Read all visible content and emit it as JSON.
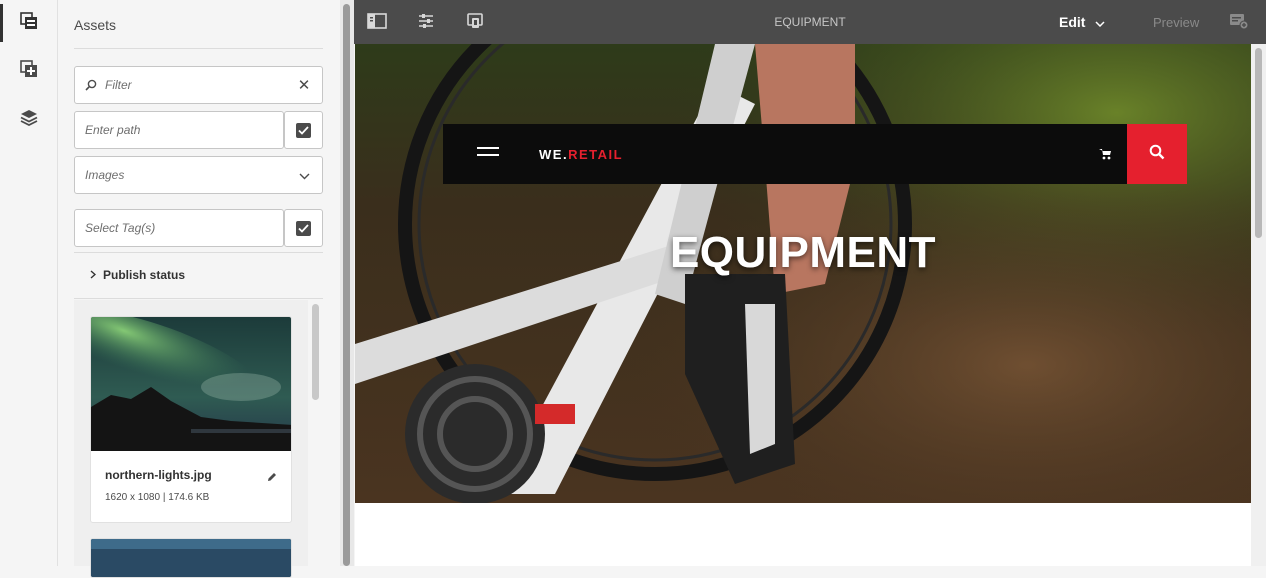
{
  "rail": {
    "items": [
      {
        "icon": "asset-finder-icon",
        "active": true
      },
      {
        "icon": "components-icon",
        "active": false
      },
      {
        "icon": "content-tree-icon",
        "active": false
      }
    ]
  },
  "panel": {
    "title": "Assets",
    "filter_placeholder": "Filter",
    "path_placeholder": "Enter path",
    "type_value": "Images",
    "tags_placeholder": "Select Tag(s)",
    "publish_status": "Publish status",
    "assets": [
      {
        "name": "northern-lights.jpg",
        "meta": "1620 x 1080 | 174.6 KB"
      }
    ]
  },
  "toolbar": {
    "page_title": "EQUIPMENT",
    "mode": "Edit",
    "preview": "Preview"
  },
  "page": {
    "brand_left": "WE.",
    "brand_right": "RETAIL",
    "hero_title": "EQUIPMENT"
  },
  "colors": {
    "brand_red": "#e5202e",
    "toolbar": "#4b4b4b",
    "nav": "#0c0c0c"
  }
}
